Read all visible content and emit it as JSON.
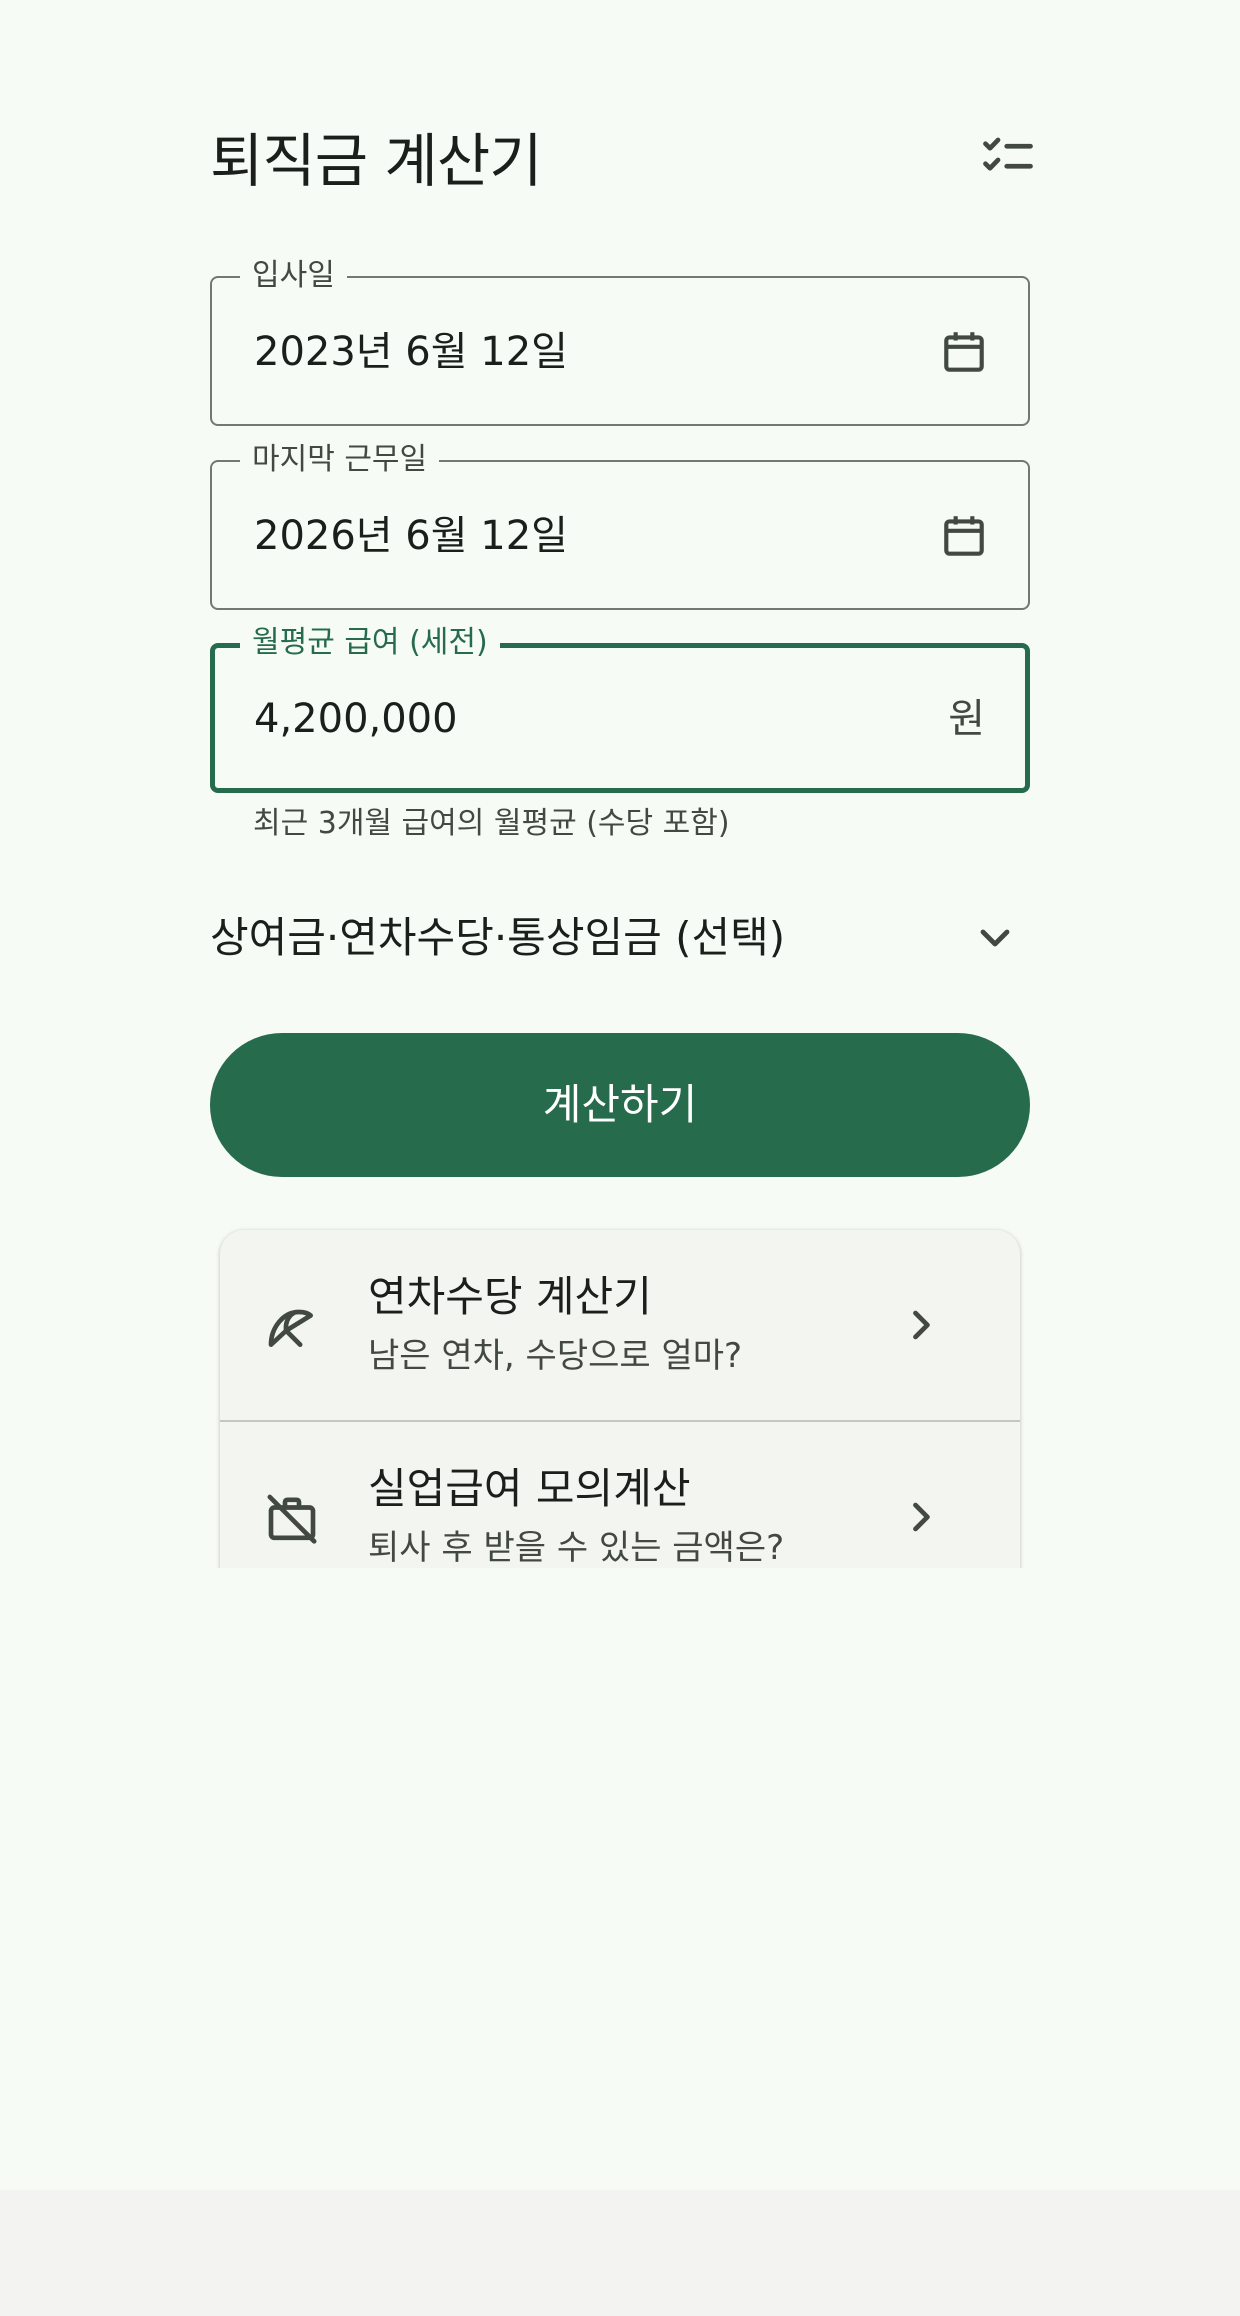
{
  "header": {
    "title": "퇴직금 계산기",
    "action_icon": "checklist-icon"
  },
  "form": {
    "start_date": {
      "label": "입사일",
      "value": "2023년 6월 12일",
      "icon": "calendar-icon"
    },
    "end_date": {
      "label": "마지막 근무일",
      "value": "2026년 6월 12일",
      "icon": "calendar-icon"
    },
    "monthly_salary": {
      "label": "월평균 급여 (세전)",
      "value": "4,200,000",
      "suffix": "원",
      "helper": "최근 3개월 급여의 월평균 (수당 포함)"
    },
    "optional_section": {
      "label": "상여금·연차수당·통상임금 (선택)",
      "icon": "chevron-down-icon",
      "expanded": false
    },
    "submit_label": "계산하기"
  },
  "links": [
    {
      "icon": "beach-umbrella-icon",
      "title": "연차수당 계산기",
      "subtitle": "남은 연차, 수당으로 얼마?"
    },
    {
      "icon": "work-off-icon",
      "title": "실업급여 모의계산",
      "subtitle": "퇴사 후 받을 수 있는 금액은?"
    }
  ],
  "colors": {
    "background": "#f7fbf5",
    "primary": "#276b4d",
    "outline": "#727972",
    "on_surface": "#1b1f1c",
    "on_surface_variant": "#424943",
    "card_surface": "#f2f5f0"
  }
}
